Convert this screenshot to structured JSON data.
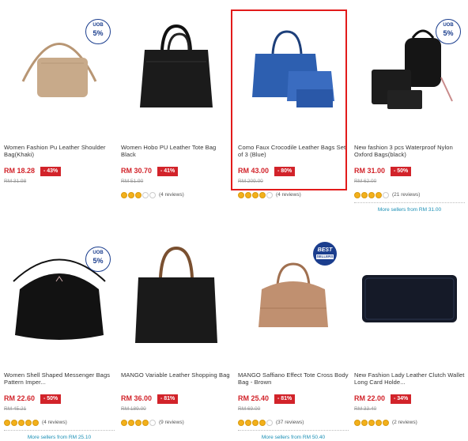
{
  "products": [
    {
      "title": "Women Fashion Pu Leather Shoulder Bag(Khaki)",
      "price": "RM 18.28",
      "discount": "- 43%",
      "old_price": "RM 31.98",
      "stars": 0,
      "reviews": "",
      "more": "",
      "badge": "uob",
      "image": "khaki-crossbody-bag-icon",
      "color": "#c8aa8a"
    },
    {
      "title": "Women Hobo PU Leather Tote Bag Black",
      "price": "RM 30.70",
      "discount": "- 41%",
      "old_price": "RM 51.90",
      "stars": 3,
      "reviews": "(4 reviews)",
      "more": "",
      "badge": "",
      "image": "black-tote-bag-icon",
      "color": "#1b1b1b"
    },
    {
      "title": "Como Faux Crocodile Leather Bags Set of 3 (Blue)",
      "price": "RM 43.00",
      "discount": "- 80%",
      "old_price": "RM 209.00",
      "stars": 4,
      "reviews": "(4 reviews)",
      "more": "",
      "badge": "",
      "image": "blue-bag-set-icon",
      "color": "#2d5fb0"
    },
    {
      "title": "New fashion 3 pcs Waterproof Nylon Oxford Bags(black)",
      "price": "RM 31.00",
      "discount": "- 50%",
      "old_price": "RM 62.00",
      "stars": 4,
      "reviews": "(21 reviews)",
      "more": "More sellers from RM 31.00",
      "badge": "uob",
      "image": "black-backpack-set-icon",
      "color": "#151515"
    },
    {
      "title": "Women Shell Shaped Messenger Bags Pattern Imper...",
      "price": "RM 22.60",
      "discount": "- 50%",
      "old_price": "RM 45.21",
      "stars": 5,
      "reviews": "(4 reviews)",
      "more": "More sellers from RM 25.10",
      "badge": "uob",
      "image": "black-shell-bag-icon",
      "color": "#121212"
    },
    {
      "title": "MANGO Variable Leather Shopping Bag",
      "price": "RM 36.00",
      "discount": "- 81%",
      "old_price": "RM 189.00",
      "stars": 4,
      "reviews": "(9 reviews)",
      "more": "",
      "badge": "",
      "image": "black-shopping-bag-icon",
      "color": "#1a1a1a"
    },
    {
      "title": "MANGO Saffiano Effect Tote Cross Body Bag - Brown",
      "price": "RM 25.40",
      "discount": "- 81%",
      "old_price": "RM 69.00",
      "stars": 4,
      "reviews": "(37 reviews)",
      "more": "More sellers from RM 50.40",
      "badge": "best",
      "image": "brown-cross-body-bag-icon",
      "color": "#c09070"
    },
    {
      "title": "New Fashion Lady Leather Clutch Wallet Long Card Holde...",
      "price": "RM 22.00",
      "discount": "- 34%",
      "old_price": "RM 33.40",
      "stars": 5,
      "reviews": "(2 reviews)",
      "more": "",
      "badge": "",
      "image": "black-wallet-icon",
      "color": "#151a28"
    }
  ],
  "badges": {
    "uob_top": "UOB",
    "uob_pct": "5%",
    "best_1": "BEST",
    "best_2": "SELLERS"
  },
  "colors": {
    "accent": "#d2232a",
    "link": "#1a8fb5",
    "highlight": "#e21b1b"
  }
}
